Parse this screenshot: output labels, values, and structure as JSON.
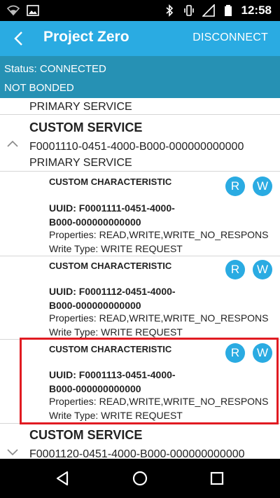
{
  "statusbar": {
    "time": "12:58"
  },
  "appbar": {
    "title": "Project Zero",
    "action": "DISCONNECT"
  },
  "connection": {
    "status": "Status: CONNECTED",
    "bond": "NOT BONDED"
  },
  "list": {
    "top_partial": "PRIMARY SERVICE",
    "service1": {
      "title": "CUSTOM SERVICE",
      "uuid": "F0001110-0451-4000-B000-000000000000",
      "type": "PRIMARY SERVICE"
    },
    "characteristics": [
      {
        "title": "CUSTOM CHARACTERISTIC",
        "uuid_line1": "UUID: F0001111-0451-4000-",
        "uuid_line2": "B000-000000000000",
        "properties": "Properties: READ,WRITE,WRITE_NO_RESPONS",
        "write_type": "Write Type: WRITE REQUEST",
        "read": "R",
        "write": "W"
      },
      {
        "title": "CUSTOM CHARACTERISTIC",
        "uuid_line1": "UUID: F0001112-0451-4000-",
        "uuid_line2": "B000-000000000000",
        "properties": "Properties: READ,WRITE,WRITE_NO_RESPONS",
        "write_type": "Write Type: WRITE REQUEST",
        "read": "R",
        "write": "W"
      },
      {
        "title": "CUSTOM CHARACTERISTIC",
        "uuid_line1": "UUID: F0001113-0451-4000-",
        "uuid_line2": "B000-000000000000",
        "properties": "Properties: READ,WRITE,WRITE_NO_RESPONS",
        "write_type": "Write Type: WRITE REQUEST",
        "read": "R",
        "write": "W"
      }
    ],
    "service2": {
      "title": "CUSTOM SERVICE",
      "uuid": "F0001120-0451-4000-B000-000000000000"
    }
  },
  "colors": {
    "accent": "#2aabe2",
    "status_band": "#2691b4",
    "highlight": "#e11b22"
  },
  "icons": [
    "wifi-icon",
    "image-icon",
    "bluetooth-icon",
    "vibrate-icon",
    "signal-icon",
    "battery-icon",
    "back-arrow-icon",
    "chevron-up-icon",
    "chevron-down-icon",
    "nav-back-icon",
    "nav-home-icon",
    "nav-recents-icon"
  ]
}
